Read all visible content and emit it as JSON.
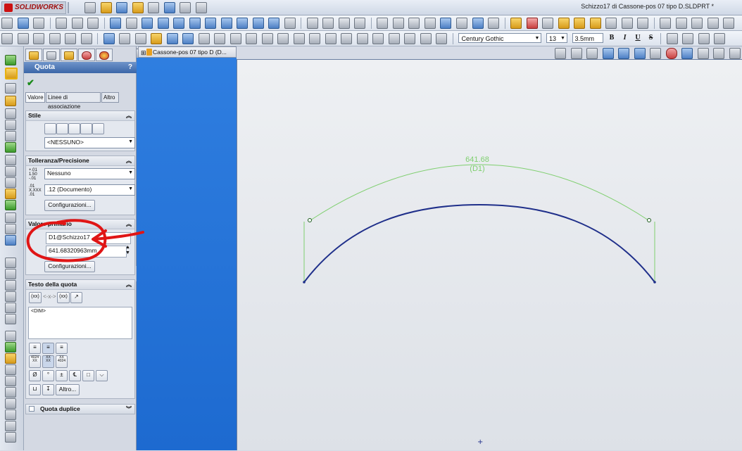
{
  "app": {
    "logo": "SOLIDWORKS",
    "window_title": "Schizzo17 di Cassone-pos 07  tipo D.SLDPRT *"
  },
  "format_bar": {
    "font": "Century Gothic",
    "size": "13",
    "height": "3.5mm",
    "bold": "B",
    "italic": "I",
    "underline": "U",
    "strike": "S"
  },
  "panel": {
    "title": "Quota",
    "help": "?",
    "confirm_icon": "checkmark-icon",
    "tabs": [
      "Valore",
      "Linee di associazione",
      "Altro"
    ],
    "style": {
      "header": "Stile",
      "selected": "<NESSUNO>"
    },
    "tolerance": {
      "header": "Tolleranza/Precisione",
      "tolerance_value": "Nessuno",
      "precision_value": ".12 (Documento)",
      "config_button": "Configurazioni..."
    },
    "primary": {
      "header": "Valore primario",
      "name": "D1@Schizzo17",
      "value": "641.68320963mm",
      "config_button": "Configurazioni..."
    },
    "dim_text": {
      "header": "Testo della quota",
      "content": "<DIM>",
      "btn_xx": "(xx)",
      "btn_xx2": "(xx)",
      "more_button": "Altro..."
    },
    "dual": {
      "header": "Quota duplice"
    }
  },
  "document": {
    "tab_label": "Cassone-pos 07  tipo D  (D..."
  },
  "sketch": {
    "dimension_value": "641.68",
    "dimension_name": "(D1)",
    "line_color": "#1f2f8a",
    "dimension_color": "#7fcf6f",
    "annotation_color": "#e01515"
  }
}
